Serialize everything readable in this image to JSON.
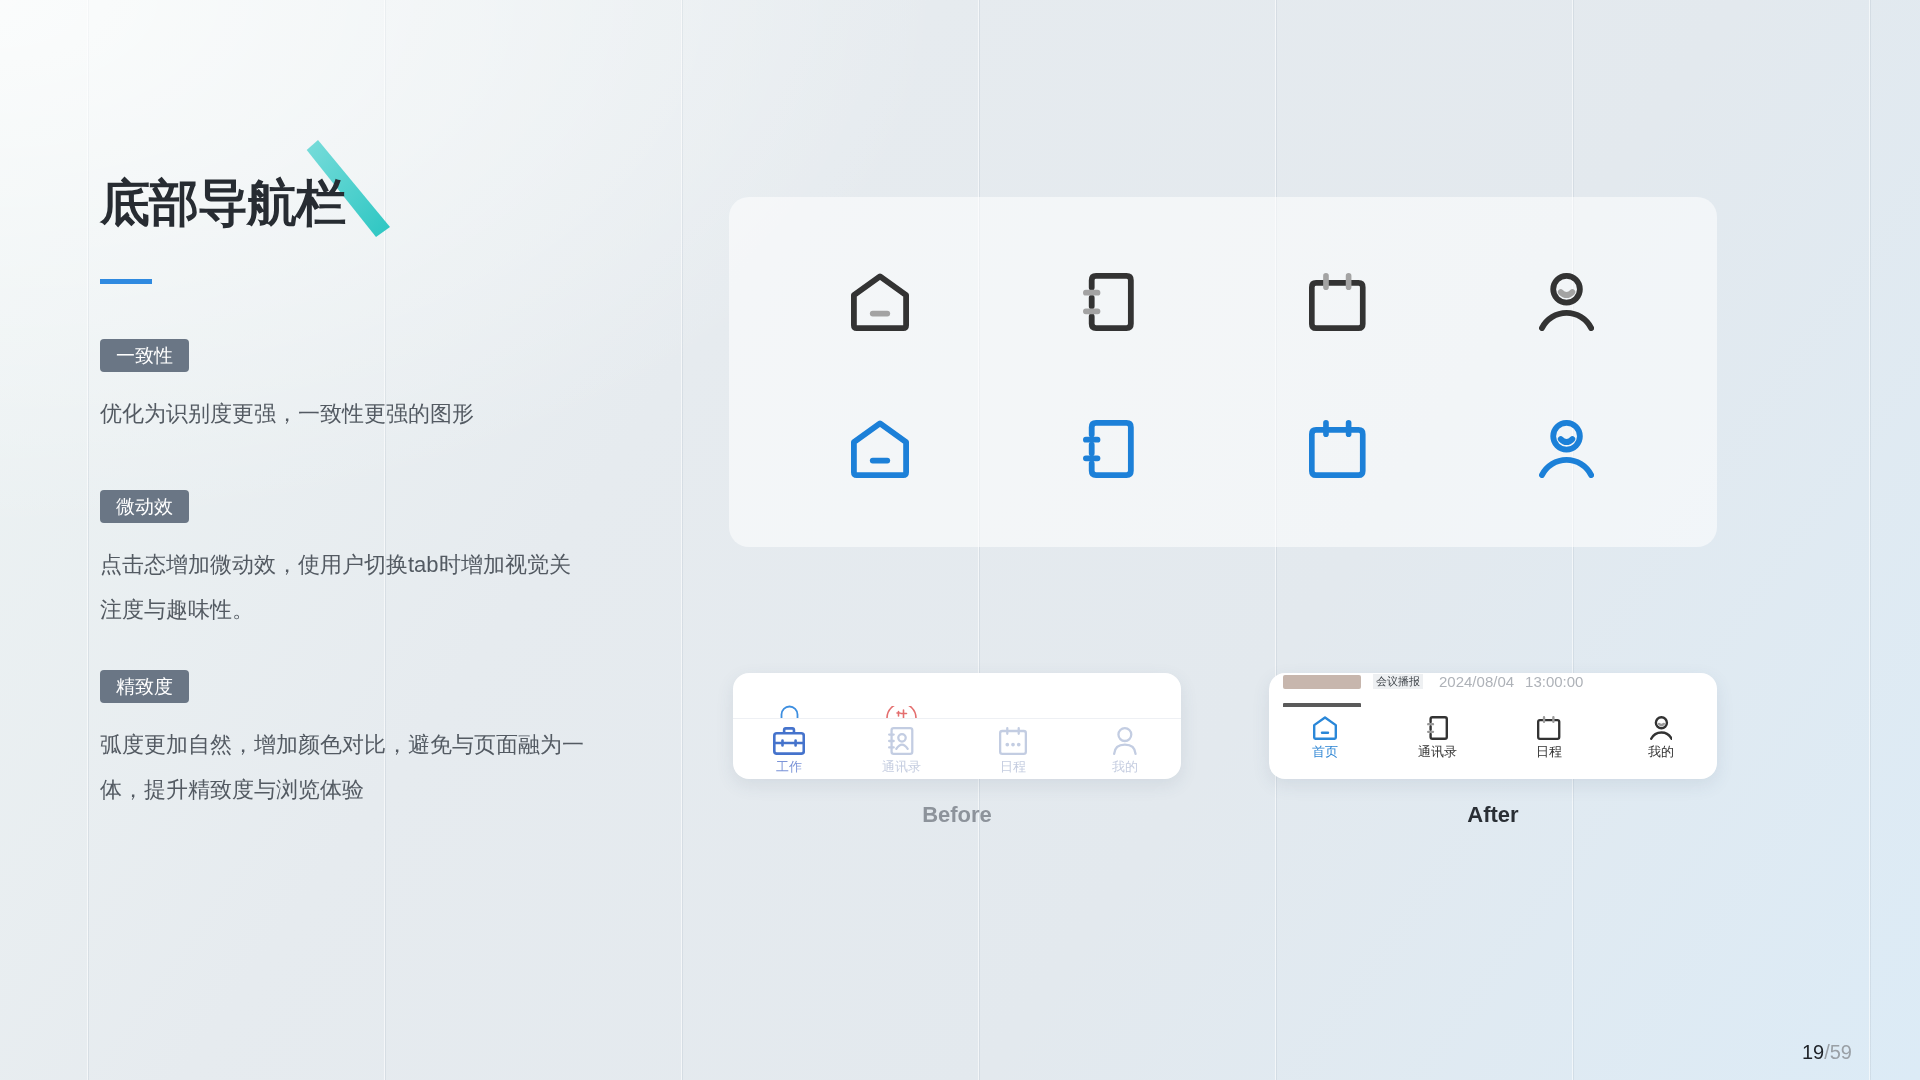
{
  "title": "底部导航栏",
  "sections": [
    {
      "tag": "一致性",
      "text": "优化为识别度更强，一致性更强的图形"
    },
    {
      "tag": "微动效",
      "text": "点击态增加微动效，使用户切换tab时增加视觉关注度与趣味性。"
    },
    {
      "tag": "精致度",
      "text": "弧度更加自然，增加颜色对比，避免与页面融为一体，提升精致度与浏览体验"
    }
  ],
  "icon_panel": {
    "rows": [
      {
        "selected": false,
        "icons": [
          {
            "kind": "home"
          },
          {
            "kind": "book"
          },
          {
            "kind": "calendar"
          },
          {
            "kind": "person"
          }
        ]
      },
      {
        "selected": true,
        "icons": [
          {
            "kind": "home"
          },
          {
            "kind": "book"
          },
          {
            "kind": "calendar"
          },
          {
            "kind": "person"
          }
        ]
      }
    ]
  },
  "comparisons": [
    {
      "kind": "before",
      "caption": "Before",
      "tabs": [
        {
          "kind": "briefcase",
          "label": "工作",
          "selected": true
        },
        {
          "kind": "contact-card",
          "label": "通讯录",
          "selected": false
        },
        {
          "kind": "calendar-dots",
          "label": "日程",
          "selected": false
        },
        {
          "kind": "person",
          "label": "我的",
          "selected": false
        }
      ]
    },
    {
      "kind": "after",
      "caption": "After",
      "preview": {
        "tag": "会议播报",
        "date": "2024/08/04",
        "time": "13:00:00"
      },
      "tabs": [
        {
          "kind": "home",
          "label": "首页",
          "selected": true
        },
        {
          "kind": "book",
          "label": "通讯录",
          "selected": false
        },
        {
          "kind": "calendar",
          "label": "日程",
          "selected": false
        },
        {
          "kind": "person",
          "label": "我的",
          "selected": false
        }
      ]
    }
  ],
  "page_number": {
    "current": "19",
    "total": "/59"
  }
}
